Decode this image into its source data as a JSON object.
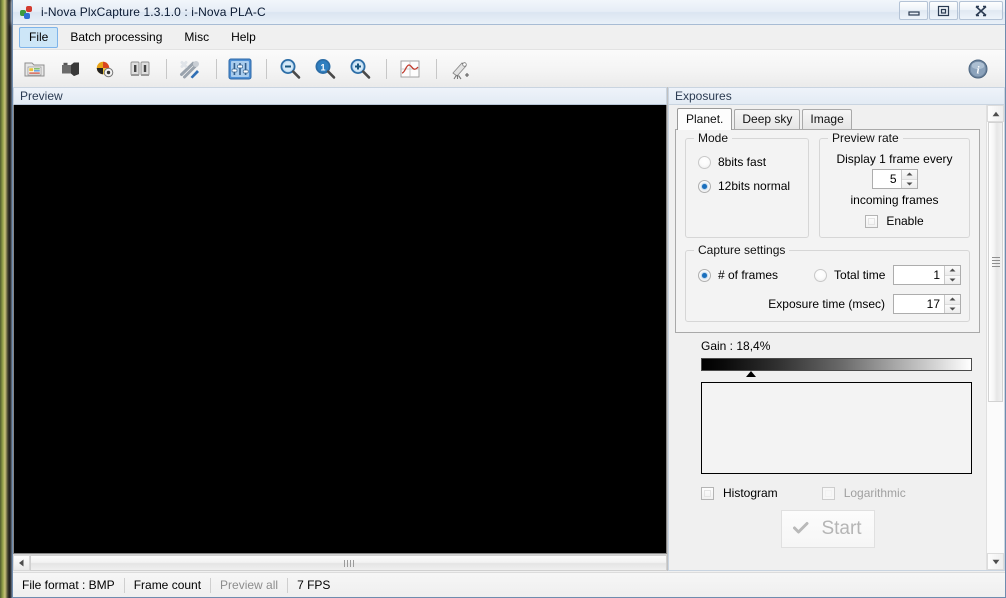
{
  "window": {
    "title": "i-Nova PlxCapture 1.3.1.0 : i-Nova PLA-C",
    "app_icon": "app-logo-icon",
    "minimize_label": "Minimize",
    "maximize_label": "Restore",
    "close_label": "Close"
  },
  "menubar": {
    "items": [
      {
        "label": "File",
        "active": true
      },
      {
        "label": "Batch processing",
        "active": false
      },
      {
        "label": "Misc",
        "active": false
      },
      {
        "label": "Help",
        "active": false
      }
    ]
  },
  "toolbar": {
    "buttons": [
      {
        "name": "open-folder-icon",
        "tip": "Open"
      },
      {
        "name": "camera-icon",
        "tip": "Camera"
      },
      {
        "name": "color-settings-icon",
        "tip": "Color settings"
      },
      {
        "name": "binning-icon",
        "tip": "Binning"
      },
      {
        "name": "tools-icon",
        "tip": "Tools"
      },
      {
        "name": "sliders-icon",
        "tip": "Adjustments"
      },
      {
        "name": "zoom-out-icon",
        "tip": "Zoom out"
      },
      {
        "name": "zoom-actual-icon",
        "tip": "Zoom 1:1"
      },
      {
        "name": "zoom-in-icon",
        "tip": "Zoom in"
      },
      {
        "name": "curves-icon",
        "tip": "Curves"
      },
      {
        "name": "telescope-icon",
        "tip": "Telescope"
      }
    ],
    "info_icon": "info-icon"
  },
  "preview": {
    "caption": "Preview",
    "hscroll": {
      "left_arrow": "scroll-left-arrow-icon"
    }
  },
  "exposures": {
    "caption": "Exposures",
    "tabs": [
      {
        "label": "Planet.",
        "selected": true
      },
      {
        "label": "Deep sky",
        "selected": false
      },
      {
        "label": "Image",
        "selected": false
      }
    ],
    "mode": {
      "title": "Mode",
      "options": [
        {
          "label": "8bits fast",
          "checked": false
        },
        {
          "label": "12bits normal",
          "checked": true
        }
      ]
    },
    "preview_rate": {
      "title": "Preview rate",
      "line1": "Display 1 frame every",
      "value": "5",
      "line2": "incoming frames",
      "enable_label": "Enable",
      "enable_checked": false
    },
    "capture_settings": {
      "title": "Capture settings",
      "frames_label": "# of frames",
      "frames_checked": true,
      "total_time_label": "Total time",
      "total_time_checked": false,
      "frames_value": "1",
      "exposure_label": "Exposure time (msec)",
      "exposure_value": "17"
    },
    "gain": {
      "label": "Gain : 18,4%",
      "percent": 18.4
    },
    "histogram": {
      "checkbox_label": "Histogram",
      "checkbox_checked": false,
      "logarithmic_label": "Logarithmic",
      "logarithmic_checked": false,
      "logarithmic_disabled": true
    },
    "start_button": {
      "label": "Start",
      "icon": "check-icon",
      "disabled": true
    }
  },
  "statusbar": {
    "cells": [
      {
        "text": "File format : BMP",
        "dim": false
      },
      {
        "text": "Frame count",
        "dim": false
      },
      {
        "text": "Preview all",
        "dim": true
      },
      {
        "text": "7 FPS",
        "dim": false
      }
    ]
  },
  "colors": {
    "accent": "#1a6fbd",
    "menu_highlight": "#cde6f7",
    "caption_text": "#2b3b52",
    "disabled_text": "#b5b5b5"
  }
}
